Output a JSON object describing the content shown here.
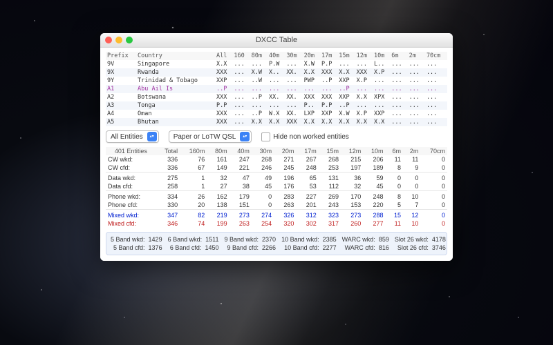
{
  "window": {
    "title": "DXCC Table"
  },
  "dxcc": {
    "headers": [
      "Prefix",
      "Country",
      "All",
      "160",
      "80m",
      "40m",
      "30m",
      "20m",
      "17m",
      "15m",
      "12m",
      "10m",
      "6m",
      "2m",
      "70cm"
    ],
    "rows": [
      {
        "prefix": "9V",
        "country": "Singapore",
        "cells": [
          "X.X",
          "...",
          "...",
          "P.W",
          "...",
          "X.W",
          "P.P",
          "...",
          "...",
          "L..",
          "...",
          "...",
          "..."
        ]
      },
      {
        "prefix": "9X",
        "country": "Rwanda",
        "cells": [
          "XXX",
          "...",
          "X.W",
          "X..",
          "XX.",
          "X.X",
          "XXX",
          "X.X",
          "XXX",
          "X.P",
          "...",
          "...",
          "..."
        ]
      },
      {
        "prefix": "9Y",
        "country": "Trinidad & Tobago",
        "cells": [
          "XXP",
          "...",
          "..W",
          "...",
          "...",
          "PWP",
          "..P",
          "XXP",
          "X.P",
          "...",
          "...",
          "...",
          "..."
        ]
      },
      {
        "prefix": "A1",
        "country": "Abu Ail Is",
        "highlight": true,
        "cells": [
          "..P",
          "...",
          "...",
          "...",
          "...",
          "...",
          "...",
          "..P",
          "...",
          "...",
          "...",
          "...",
          "..."
        ]
      },
      {
        "prefix": "A2",
        "country": "Botswana",
        "cells": [
          "XXX",
          "...",
          "..P",
          "XX.",
          "XX.",
          "XXX",
          "XXX",
          "XXP",
          "X.X",
          "XPX",
          "...",
          "...",
          "..."
        ]
      },
      {
        "prefix": "A3",
        "country": "Tonga",
        "cells": [
          "P.P",
          "...",
          "...",
          "...",
          "...",
          "P..",
          "P.P",
          "..P",
          "...",
          "...",
          "...",
          "...",
          "..."
        ]
      },
      {
        "prefix": "A4",
        "country": "Oman",
        "cells": [
          "XXX",
          "...",
          "..P",
          "W.X",
          "XX.",
          "LXP",
          "XXP",
          "X.W",
          "X.P",
          "XXP",
          "...",
          "...",
          "..."
        ]
      },
      {
        "prefix": "A5",
        "country": "Bhutan",
        "cells": [
          "XXX",
          "...",
          "X.X",
          "X.X",
          "XXX",
          "X.X",
          "X.X",
          "X.X",
          "X.X",
          "X.X",
          "...",
          "...",
          "..."
        ]
      }
    ]
  },
  "controls": {
    "entitySelect": "All Entities",
    "qslSelect": "Paper or LoTW QSL",
    "hideNonWorked": "Hide non worked entities"
  },
  "stats": {
    "entitiesLabel": "401 Entities",
    "cols": [
      "Total",
      "160m",
      "80m",
      "40m",
      "30m",
      "20m",
      "17m",
      "15m",
      "12m",
      "10m",
      "6m",
      "2m",
      "70cm"
    ],
    "rows": [
      {
        "label": "CW wkd:",
        "v": [
          336,
          76,
          161,
          247,
          268,
          271,
          267,
          268,
          215,
          206,
          11,
          11,
          0
        ]
      },
      {
        "label": "CW cfd:",
        "v": [
          336,
          67,
          149,
          221,
          246,
          245,
          248,
          253,
          197,
          189,
          8,
          9,
          0
        ]
      },
      {
        "label": "Data wkd:",
        "sep": true,
        "v": [
          275,
          1,
          32,
          47,
          49,
          196,
          65,
          131,
          36,
          59,
          0,
          0,
          0
        ]
      },
      {
        "label": "Data cfd:",
        "v": [
          258,
          1,
          27,
          38,
          45,
          176,
          53,
          112,
          32,
          45,
          0,
          0,
          0
        ]
      },
      {
        "label": "Phone wkd:",
        "sep": true,
        "v": [
          334,
          26,
          162,
          179,
          0,
          283,
          227,
          269,
          170,
          248,
          8,
          10,
          0
        ]
      },
      {
        "label": "Phone cfd:",
        "v": [
          330,
          20,
          138,
          151,
          0,
          263,
          201,
          243,
          153,
          220,
          5,
          7,
          0
        ]
      },
      {
        "label": "Mixed wkd:",
        "sep": true,
        "cls": "blue",
        "v": [
          347,
          82,
          219,
          273,
          274,
          326,
          312,
          323,
          273,
          288,
          15,
          12,
          0
        ]
      },
      {
        "label": "Mixed cfd:",
        "cls": "red",
        "v": [
          346,
          74,
          199,
          263,
          254,
          320,
          302,
          317,
          260,
          277,
          11,
          10,
          0
        ]
      }
    ]
  },
  "summary": [
    {
      "label": "5 Band wkd:",
      "value": 1429
    },
    {
      "label": "6 Band wkd:",
      "value": 1511
    },
    {
      "label": "9 Band wkd:",
      "value": 2370
    },
    {
      "label": "10 Band wkd:",
      "value": 2385
    },
    {
      "label": "WARC wkd:",
      "value": 859
    },
    {
      "label": "Slot 26 wkd:",
      "value": 4178
    },
    {
      "label": "5 Band cfd:",
      "value": 1376
    },
    {
      "label": "6 Band cfd:",
      "value": 1450
    },
    {
      "label": "9 Band cfd:",
      "value": 2266
    },
    {
      "label": "10 Band cfd:",
      "value": 2277
    },
    {
      "label": "WARC cfd:",
      "value": 816
    },
    {
      "label": "Slot 26 cfd:",
      "value": 3746
    }
  ]
}
